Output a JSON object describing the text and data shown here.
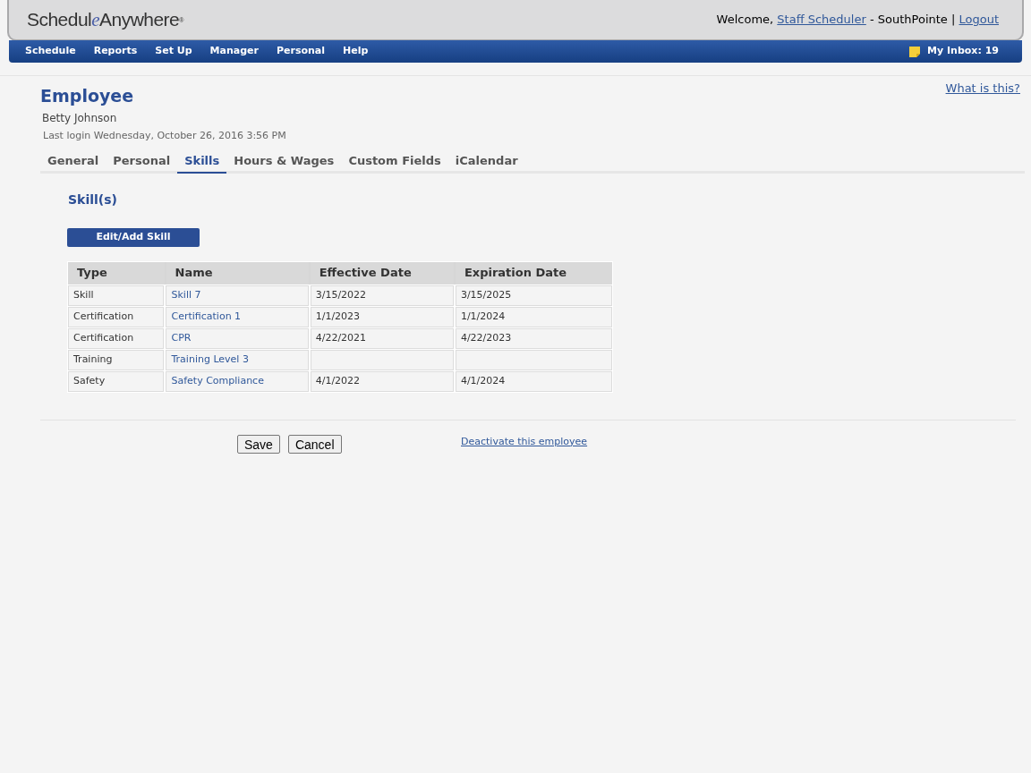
{
  "header": {
    "logo": {
      "start": "Schedul",
      "swoosh_letter": "e",
      "end": "Anywhere",
      "mark": "®"
    },
    "welcome": "Welcome, ",
    "user": "Staff Scheduler",
    "site": " - SouthPointe | ",
    "logout": "Logout"
  },
  "nav": {
    "items": [
      "Schedule",
      "Reports",
      "Set Up",
      "Manager",
      "Personal",
      "Help"
    ],
    "inbox": "My Inbox: 19"
  },
  "help_link": "What is this?",
  "employee": {
    "title": "Employee",
    "name": "Betty Johnson",
    "last_login": "Last login Wednesday, October 26, 2016 3:56 PM"
  },
  "tabs": [
    {
      "label": "General",
      "selected": false
    },
    {
      "label": "Personal",
      "selected": false
    },
    {
      "label": "Skills",
      "selected": true
    },
    {
      "label": "Hours & Wages",
      "selected": false
    },
    {
      "label": "Custom Fields",
      "selected": false
    },
    {
      "label": "iCalendar",
      "selected": false
    }
  ],
  "section_title": "Skill(s)",
  "edit_button": "Edit/Add Skill",
  "table": {
    "columns": [
      "Type",
      "Name",
      "Effective Date",
      "Expiration Date"
    ],
    "rows": [
      [
        "Skill",
        "Skill 7",
        "3/15/2022",
        "3/15/2025"
      ],
      [
        "Certification",
        "Certification 1",
        "1/1/2023",
        "1/1/2024"
      ],
      [
        "Certification",
        "CPR",
        "4/22/2021",
        "4/22/2023"
      ],
      [
        "Training",
        "Training Level 3",
        "",
        ""
      ],
      [
        "Safety",
        "Safety Compliance",
        "4/1/2022",
        "4/1/2024"
      ]
    ]
  },
  "buttons": [
    "Save",
    "Cancel"
  ],
  "deactivate_link": "Deactivate this employee"
}
